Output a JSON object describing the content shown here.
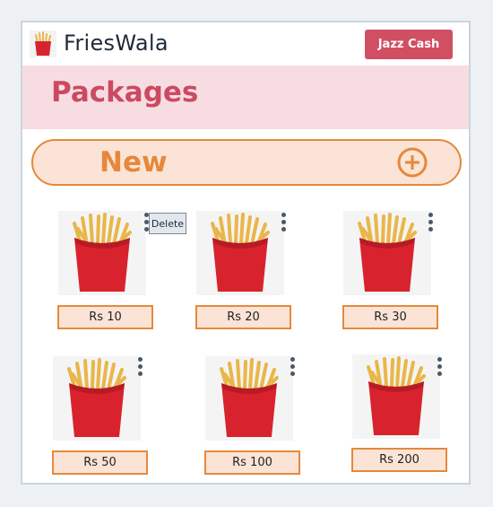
{
  "header": {
    "app_title": "FriesWala",
    "logo_icon": "fries-logo-icon",
    "payment_button": "Jazz Cash"
  },
  "banner": {
    "title": "Packages"
  },
  "new_package": {
    "label": "New",
    "icon": "plus-circle-icon"
  },
  "packages": [
    {
      "price": "Rs 10"
    },
    {
      "price": "Rs 20"
    },
    {
      "price": "Rs 30"
    },
    {
      "price": "Rs 50"
    },
    {
      "price": "Rs 100"
    },
    {
      "price": "Rs 200"
    }
  ],
  "context_menu": {
    "delete_label": "Delete"
  },
  "colors": {
    "accent_pink": "#d14f63",
    "banner_bg": "#f7dde2",
    "accent_orange": "#e6883c",
    "orange_bg": "#fbe4d6"
  }
}
